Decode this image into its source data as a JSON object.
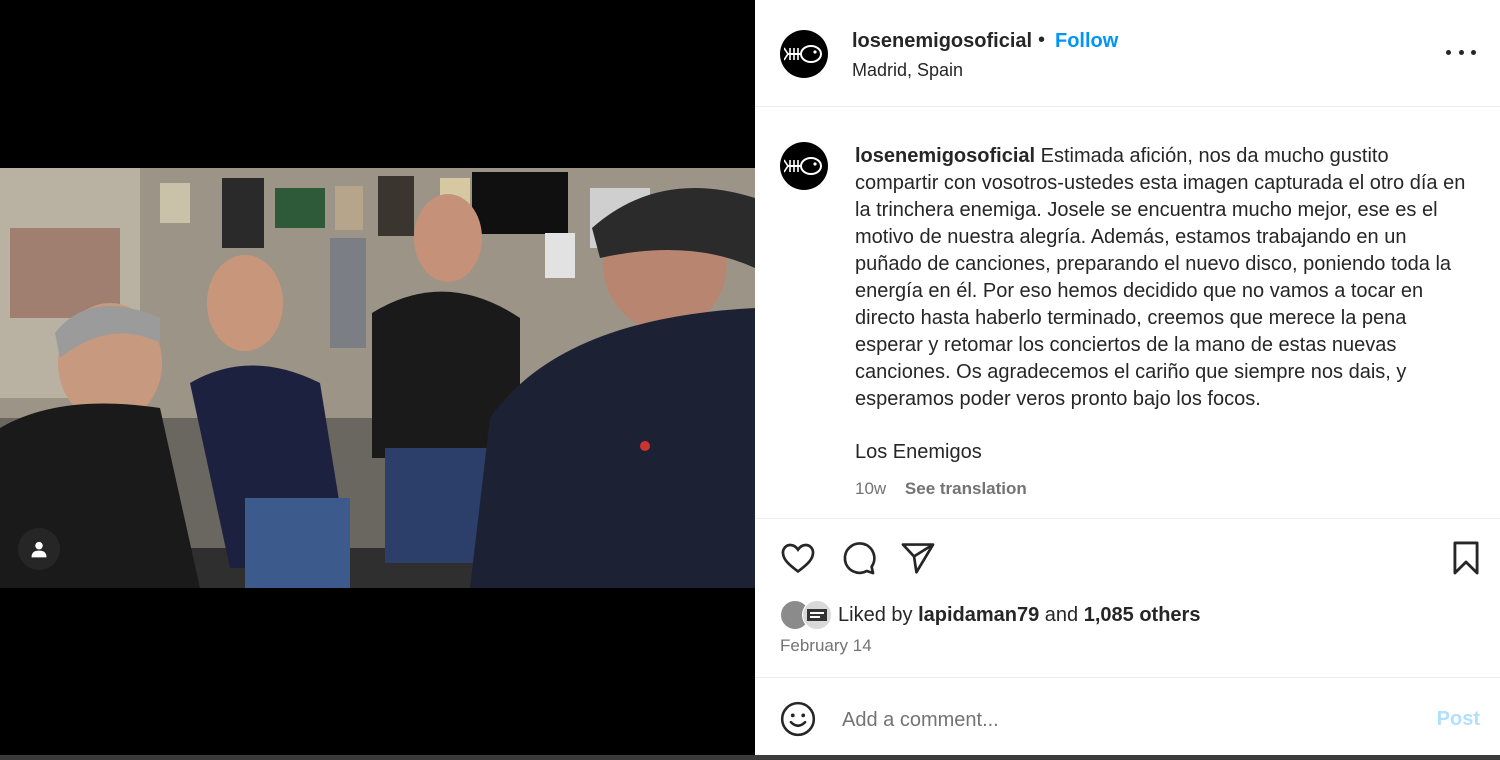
{
  "post": {
    "username": "losenemigosoficial",
    "follow_label": "Follow",
    "separator": "•",
    "location": "Madrid, Spain",
    "caption_text": "Estimada afición, nos da mucho gustito compartir con vosotros-ustedes esta imagen capturada el otro día en la trinchera enemiga. Josele se encuentra mucho mejor, ese es el motivo de nuestra alegría. Además, estamos trabajando en un puñado de canciones, preparando el nuevo disco, poniendo toda la energía en él. Por eso hemos decidido que no vamos a tocar en directo hasta haberlo terminado, creemos que merece la pena esperar y retomar los conciertos de la mano de estas nuevas canciones. Os agradecemos el cariño que siempre nos dais, y esperamos poder veros pronto bajo los focos.",
    "signature": "Los Enemigos",
    "age": "10w",
    "translate_label": "See translation",
    "likes": {
      "prefix": "Liked by",
      "first_user": "lapidaman79",
      "joiner": "and",
      "others": "1,085 others"
    },
    "date": "February 14"
  },
  "comment": {
    "placeholder": "Add a comment...",
    "post_label": "Post"
  },
  "icons": {
    "tag": "user-tag-icon",
    "more": "more-options-icon",
    "like": "heart-icon",
    "comment": "comment-bubble-icon",
    "share": "paper-plane-icon",
    "save": "bookmark-icon",
    "emoji": "smiley-icon"
  },
  "colors": {
    "accent": "#0095f6",
    "text": "#262626",
    "muted": "#737373",
    "post_disabled": "#b2dffc"
  }
}
